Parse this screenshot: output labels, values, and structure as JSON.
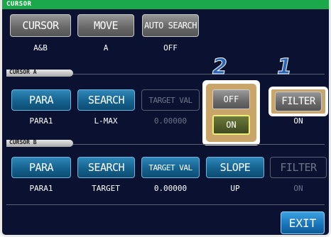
{
  "title": "CURSOR",
  "top_row": {
    "cursor": {
      "label": "CURSOR",
      "value": "A&B"
    },
    "move": {
      "label": "MOVE",
      "value": "A"
    },
    "auto_search": {
      "label": "AUTO SEARCH",
      "value": "OFF"
    }
  },
  "cursor_a": {
    "header": "CURSOR A",
    "para": {
      "label": "PARA",
      "value": "PARA1"
    },
    "search": {
      "label": "SEARCH",
      "value": "L-MAX"
    },
    "target_val": {
      "label": "TARGET VAL",
      "value": "0.00000"
    },
    "filter": {
      "label": "FILTER",
      "value": "ON"
    }
  },
  "popup": {
    "options": [
      "OFF",
      "ON"
    ],
    "selected": "ON"
  },
  "callouts": {
    "filter": "1",
    "popup": "2"
  },
  "cursor_b": {
    "header": "CURSOR B",
    "para": {
      "label": "PARA",
      "value": "PARA1"
    },
    "search": {
      "label": "SEARCH",
      "value": "TARGET"
    },
    "target_val": {
      "label": "TARGET VAL",
      "value": "0.00000"
    },
    "slope": {
      "label": "SLOPE",
      "value": "UP"
    },
    "filter": {
      "label": "FILTER",
      "value": "ON"
    }
  },
  "exit_label": "EXIT",
  "colors": {
    "accent": "#1aa84a",
    "screen_bg": "#0b1130",
    "button": "#15628f",
    "highlight": "#c9a56a"
  }
}
